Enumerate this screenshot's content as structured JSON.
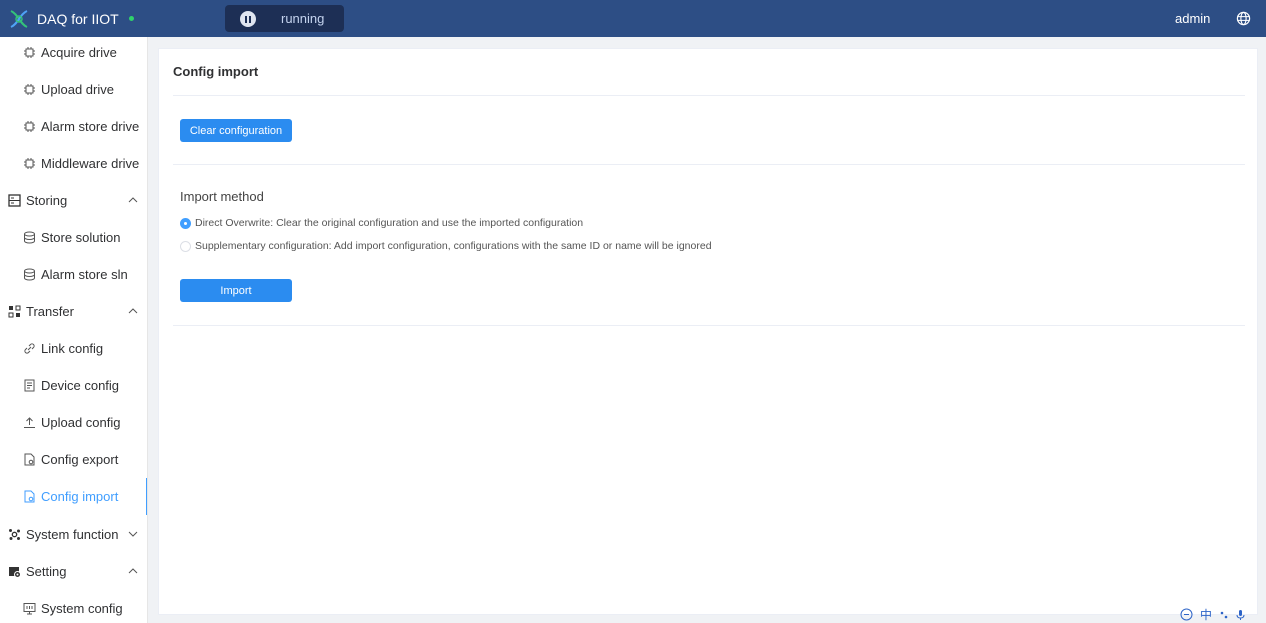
{
  "header": {
    "app_title": "DAQ for IIOT",
    "run_status": "running",
    "user": "admin"
  },
  "sidebar": {
    "items": [
      {
        "label": "Acquire drive",
        "icon": "chip-icon"
      },
      {
        "label": "Upload drive",
        "icon": "chip-icon"
      },
      {
        "label": "Alarm store drive",
        "icon": "chip-icon"
      },
      {
        "label": "Middleware drive",
        "icon": "chip-icon"
      },
      {
        "label": "Storing",
        "icon": "storage-icon"
      },
      {
        "label": "Store solution",
        "icon": "database-icon"
      },
      {
        "label": "Alarm store sln",
        "icon": "database-icon"
      },
      {
        "label": "Transfer",
        "icon": "transfer-icon"
      },
      {
        "label": "Link config",
        "icon": "link-icon"
      },
      {
        "label": "Device config",
        "icon": "document-icon"
      },
      {
        "label": "Upload config",
        "icon": "upload-icon"
      },
      {
        "label": "Config export",
        "icon": "file-icon"
      },
      {
        "label": "Config import",
        "icon": "file-icon"
      },
      {
        "label": "System function",
        "icon": "system-icon"
      },
      {
        "label": "Setting",
        "icon": "setting-icon"
      },
      {
        "label": "System config",
        "icon": "monitor-icon"
      }
    ]
  },
  "main": {
    "title": "Config import",
    "clear_label": "Clear configuration",
    "method_label": "Import method",
    "options": [
      {
        "label": "Direct Overwrite: Clear the original configuration and use the imported configuration",
        "checked": true
      },
      {
        "label": "Supplementary configuration: Add import configuration, configurations with the same ID or name will be ignored",
        "checked": false
      }
    ],
    "import_label": "Import"
  },
  "tray": {
    "ime": "中"
  },
  "colors": {
    "header": "#2d4e85",
    "accent": "#409eff",
    "button": "#2b8cf0"
  }
}
